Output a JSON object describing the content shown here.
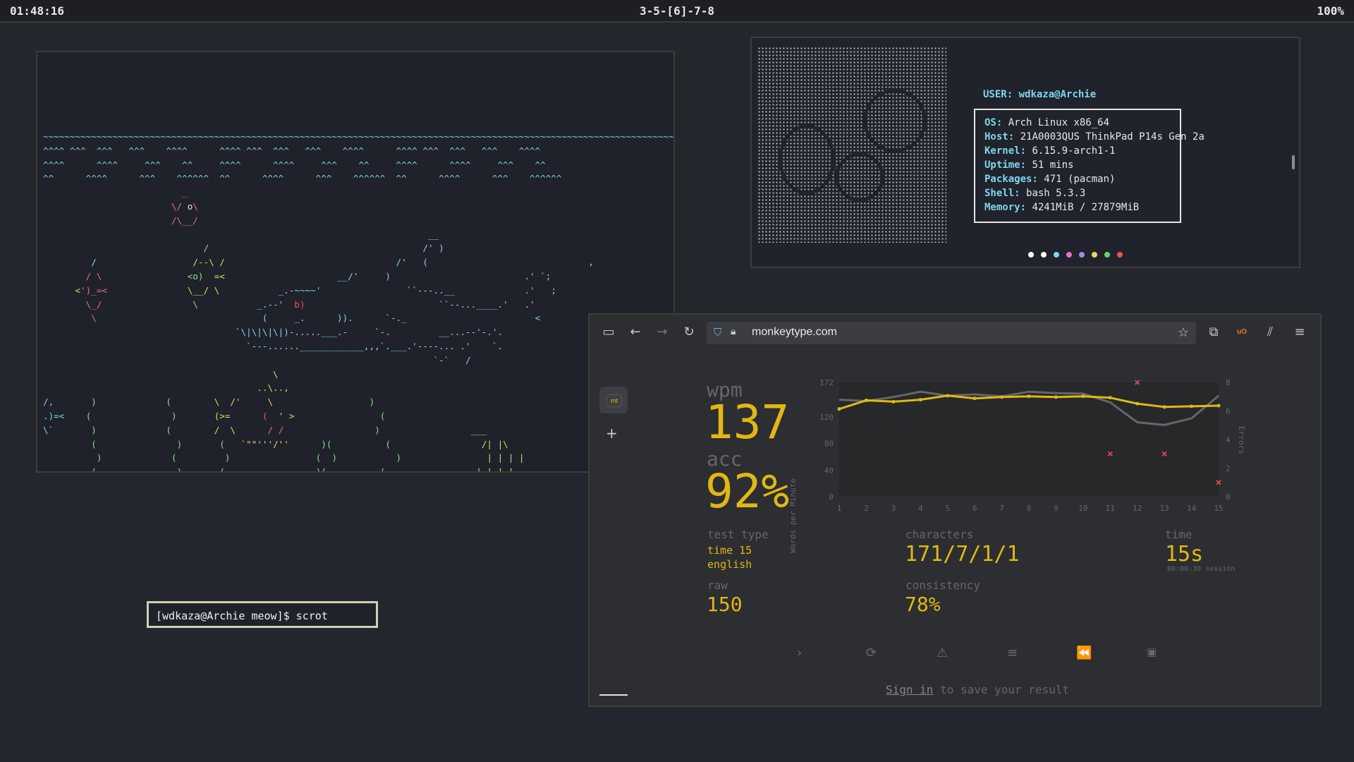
{
  "topbar": {
    "clock": "01:48:16",
    "workspaces": "3-5-[6]-7-8",
    "battery": "100%"
  },
  "fetch": {
    "user_label": "USER:",
    "user_value": "wdkaza@Archie",
    "rows": [
      {
        "key": "OS:",
        "value": "Arch Linux x86_64"
      },
      {
        "key": "Host:",
        "value": "21A0003QUS ThinkPad P14s Gen 2a"
      },
      {
        "key": "Kernel:",
        "value": "6.15.9-arch1-1"
      },
      {
        "key": "Uptime:",
        "value": "51 mins"
      },
      {
        "key": "Packages:",
        "value": "471 (pacman)"
      },
      {
        "key": "Shell:",
        "value": "bash 5.3.3"
      },
      {
        "key": "Memory:",
        "value": "4241MiB / 27879MiB"
      }
    ],
    "dot_colors": [
      "#ffffff",
      "#ffffff",
      "#7fd5ec",
      "#e86fd0",
      "#a98ae0",
      "#e3d86b",
      "#6ad46a",
      "#ef5050"
    ]
  },
  "small_terminal": {
    "prompt": "[wdkaza@Archie meow]$ scrot"
  },
  "browser": {
    "url": "monkeytype.com",
    "favicon_text": "mt"
  },
  "results": {
    "wpm_label": "wpm",
    "wpm": "137",
    "acc_label": "acc",
    "acc": "92%",
    "test_type_label": "test type",
    "test_type_1": "time 15",
    "test_type_2": "english",
    "raw_label": "raw",
    "raw": "150",
    "characters_label": "characters",
    "characters": "171/7/1/1",
    "consistency_label": "consistency",
    "consistency": "78%",
    "time_label": "time",
    "time": "15s",
    "time_sub": "00:00:30 session",
    "signin_link": "Sign in",
    "signin_rest": " to save your result"
  },
  "chart_data": {
    "type": "line",
    "x": [
      1,
      2,
      3,
      4,
      5,
      6,
      7,
      8,
      9,
      10,
      11,
      12,
      13,
      14,
      15
    ],
    "ylabel": "Words per Minute",
    "y2label": "Errors",
    "yticks": [
      0,
      40,
      80,
      120,
      172
    ],
    "y2ticks": [
      0,
      2,
      4,
      6,
      8
    ],
    "ylim": [
      0,
      172
    ],
    "y2lim": [
      0,
      8
    ],
    "series": [
      {
        "name": "wpm",
        "color": "#e2b714",
        "values": [
          132,
          145,
          143,
          146,
          152,
          148,
          150,
          151,
          150,
          151,
          149,
          140,
          135,
          136,
          137
        ]
      },
      {
        "name": "raw",
        "color": "#646669",
        "values": [
          146,
          144,
          150,
          158,
          152,
          154,
          151,
          158,
          156,
          155,
          142,
          112,
          108,
          118,
          152
        ]
      },
      {
        "name": "errors",
        "color": "#ca4754",
        "points": [
          [
            11,
            3
          ],
          [
            12,
            8
          ],
          [
            13,
            3
          ],
          [
            15,
            1
          ]
        ]
      }
    ]
  }
}
